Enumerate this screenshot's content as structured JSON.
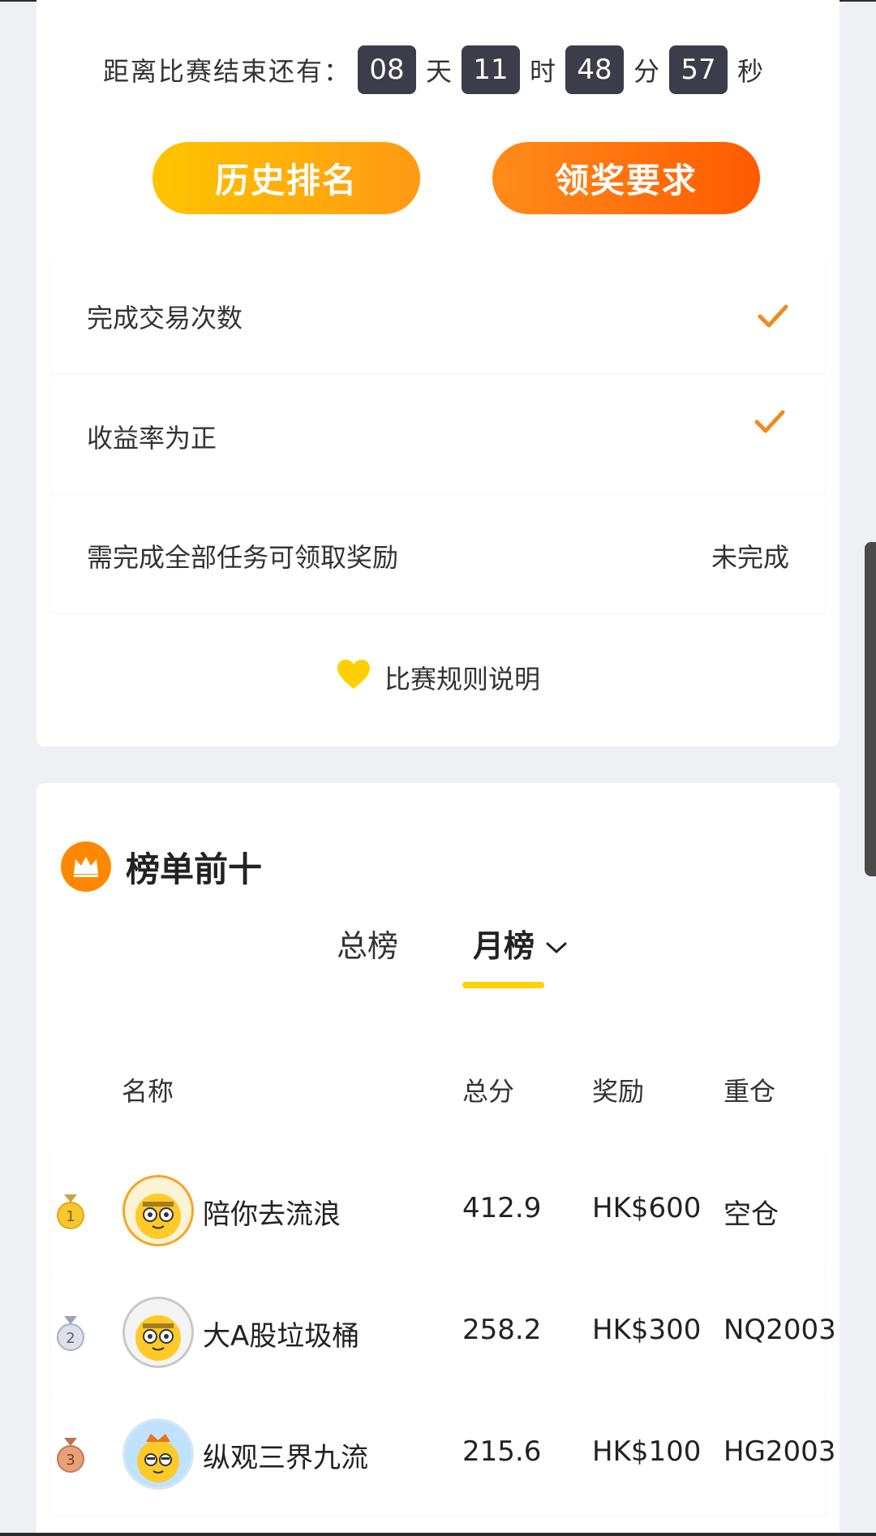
{
  "countdown": {
    "label": "距离比赛结束还有：",
    "days": "08",
    "days_unit": "天",
    "hours": "11",
    "hours_unit": "时",
    "minutes": "48",
    "minutes_unit": "分",
    "seconds": "57",
    "seconds_unit": "秒"
  },
  "buttons": {
    "history": "历史排名",
    "reward": "领奖要求"
  },
  "tasks": [
    {
      "label": "完成交易次数",
      "status": "done"
    },
    {
      "label": "收益率为正",
      "status": "done"
    },
    {
      "label": "需完成全部任务可领取奖励",
      "status_text": "未完成"
    }
  ],
  "rules_link": "比赛规则说明",
  "leaderboard": {
    "title": "榜单前十",
    "tabs": [
      {
        "label": "总榜",
        "active": false
      },
      {
        "label": "月榜",
        "active": true
      }
    ],
    "columns": {
      "name": "名称",
      "score": "总分",
      "reward": "奖励",
      "position": "重仓"
    },
    "rows": [
      {
        "rank": "1",
        "name": "陪你去流浪",
        "score": "412.9",
        "reward": "HK$600",
        "position": "空仓"
      },
      {
        "rank": "2",
        "name": "大A股垃圾桶",
        "score": "258.2",
        "reward": "HK$300",
        "position": "NQ2003"
      },
      {
        "rank": "3",
        "name": "纵观三界九流",
        "score": "215.6",
        "reward": "HK$100",
        "position": "HG2003"
      }
    ]
  },
  "colors": {
    "accent_orange": "#ff8800",
    "accent_yellow": "#ffd200",
    "countdown_box": "#3b3d4a"
  }
}
